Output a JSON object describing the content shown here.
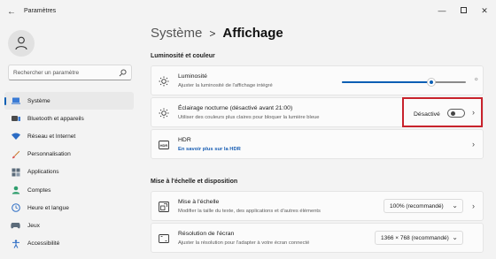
{
  "window": {
    "title": "Paramètres"
  },
  "user": {
    "avatar_icon": "person-icon"
  },
  "search": {
    "placeholder": "Rechercher un paramètre",
    "icon": "search-icon"
  },
  "sidebar": {
    "items": [
      {
        "label": "Système",
        "icon": "laptop-icon",
        "active": true
      },
      {
        "label": "Bluetooth et appareils",
        "icon": "bluetooth-icon"
      },
      {
        "label": "Réseau et Internet",
        "icon": "wifi-icon"
      },
      {
        "label": "Personnalisation",
        "icon": "brush-icon"
      },
      {
        "label": "Applications",
        "icon": "apps-icon"
      },
      {
        "label": "Comptes",
        "icon": "person-icon"
      },
      {
        "label": "Heure et langue",
        "icon": "globe-clock-icon"
      },
      {
        "label": "Jeux",
        "icon": "gamepad-icon"
      },
      {
        "label": "Accessibilité",
        "icon": "accessibility-icon"
      }
    ]
  },
  "header": {
    "parent": "Système",
    "separator": ">",
    "current": "Affichage"
  },
  "sections": {
    "brightness": {
      "title": "Luminosité et couleur"
    },
    "scale": {
      "title": "Mise à l'échelle et disposition"
    }
  },
  "cards": {
    "luminosite": {
      "title": "Luminosité",
      "subtitle": "Ajuster la luminosité de l'affichage intégré",
      "slider_value": 0.72
    },
    "night_light": {
      "title": "Éclairage nocturne (désactivé avant 21:00)",
      "subtitle": "Utiliser des couleurs plus claires pour bloquer la lumière bleue",
      "status": "Désactivé",
      "toggle_on": false
    },
    "hdr": {
      "title": "HDR",
      "link": "En savoir plus sur la HDR"
    },
    "scale": {
      "title": "Mise à l'échelle",
      "subtitle": "Modifier la taille du texte, des applications et d'autres éléments",
      "value": "100% (recommandé)"
    },
    "resolution": {
      "title": "Résolution de l'écran",
      "subtitle": "Ajuster la résolution pour l'adapter à  votre  écran connecté",
      "value": "1366 × 768 (recommandé)"
    }
  },
  "colors": {
    "accent": "#0a5fb4",
    "highlight": "#c8232c",
    "background": "#f3f3f3",
    "card": "#fbfbfb"
  }
}
